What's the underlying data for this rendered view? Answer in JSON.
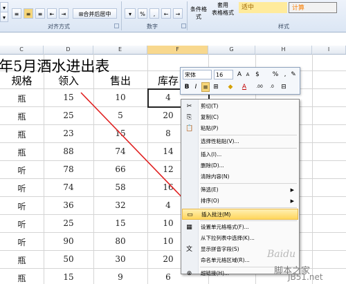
{
  "ribbon": {
    "align_group_label": "对齐方式",
    "number_group_label": "数字",
    "styles_group_label": "样式",
    "merge_center_label": "合并后居中",
    "percent_symbol": "%",
    "comma_symbol": ",",
    "conditional_format_label": "条件格式",
    "table_format_label": "表格格式",
    "apply_label": "套用",
    "style_moderate": "适中",
    "style_calculate": "计算"
  },
  "columns": [
    "C",
    "D",
    "E",
    "F",
    "G",
    "H",
    "I"
  ],
  "sheet": {
    "title": "年5月酒水进出表",
    "headers": [
      "规格",
      "领入",
      "售出",
      "库存"
    ],
    "rows": [
      [
        "瓶",
        "15",
        "10",
        "4"
      ],
      [
        "瓶",
        "25",
        "5",
        "20"
      ],
      [
        "瓶",
        "23",
        "15",
        "8"
      ],
      [
        "瓶",
        "88",
        "74",
        "14"
      ],
      [
        "听",
        "78",
        "66",
        "12"
      ],
      [
        "听",
        "74",
        "58",
        "16"
      ],
      [
        "听",
        "36",
        "32",
        "4"
      ],
      [
        "听",
        "25",
        "15",
        "10"
      ],
      [
        "听",
        "90",
        "80",
        "10"
      ],
      [
        "瓶",
        "50",
        "30",
        "20"
      ],
      [
        "瓶",
        "15",
        "9",
        "6"
      ]
    ]
  },
  "mini_toolbar": {
    "font_name": "宋体",
    "font_size": "16",
    "grow_font": "A",
    "shrink_font": "A",
    "currency": "$",
    "percent": "%",
    "comma": ",",
    "bold": "B",
    "italic": "I",
    "align_center": "≡",
    "font_color_letter": "A",
    "decrease_decimal": ".00",
    "increase_decimal": ".0"
  },
  "context_menu": {
    "items": [
      {
        "label": "剪切(T)",
        "icon": "scissors-icon",
        "submenu": false
      },
      {
        "label": "复制(C)",
        "icon": "copy-icon",
        "submenu": false
      },
      {
        "label": "粘贴(P)",
        "icon": "paste-icon",
        "submenu": false
      },
      {
        "label": "选择性粘贴(V)...",
        "icon": "",
        "submenu": false
      },
      {
        "label": "插入(I)...",
        "icon": "",
        "submenu": false
      },
      {
        "label": "删除(D)...",
        "icon": "",
        "submenu": false
      },
      {
        "label": "清除内容(N)",
        "icon": "",
        "submenu": false
      },
      {
        "label": "筛选(E)",
        "icon": "",
        "submenu": true
      },
      {
        "label": "排序(O)",
        "icon": "",
        "submenu": true
      },
      {
        "label": "插入批注(M)",
        "icon": "comment-icon",
        "submenu": false,
        "highlighted": true
      },
      {
        "label": "设置单元格格式(F)...",
        "icon": "format-cells-icon",
        "submenu": false
      },
      {
        "label": "从下拉列表中选择(K)...",
        "icon": "",
        "submenu": false
      },
      {
        "label": "显示拼音字段(S)",
        "icon": "phonetic-icon",
        "submenu": false
      },
      {
        "label": "命名单元格区域(R)...",
        "icon": "",
        "submenu": false
      },
      {
        "label": "超链接(H)...",
        "icon": "hyperlink-icon",
        "submenu": false
      }
    ]
  },
  "watermark": {
    "line1": "脚本之家",
    "line2": "JB51.net",
    "logo": "Baidu"
  },
  "colors": {
    "annotation_arrow": "#e02020",
    "menu_highlight": "#ffd65b",
    "ribbon_bg": "#dbe6f4"
  }
}
